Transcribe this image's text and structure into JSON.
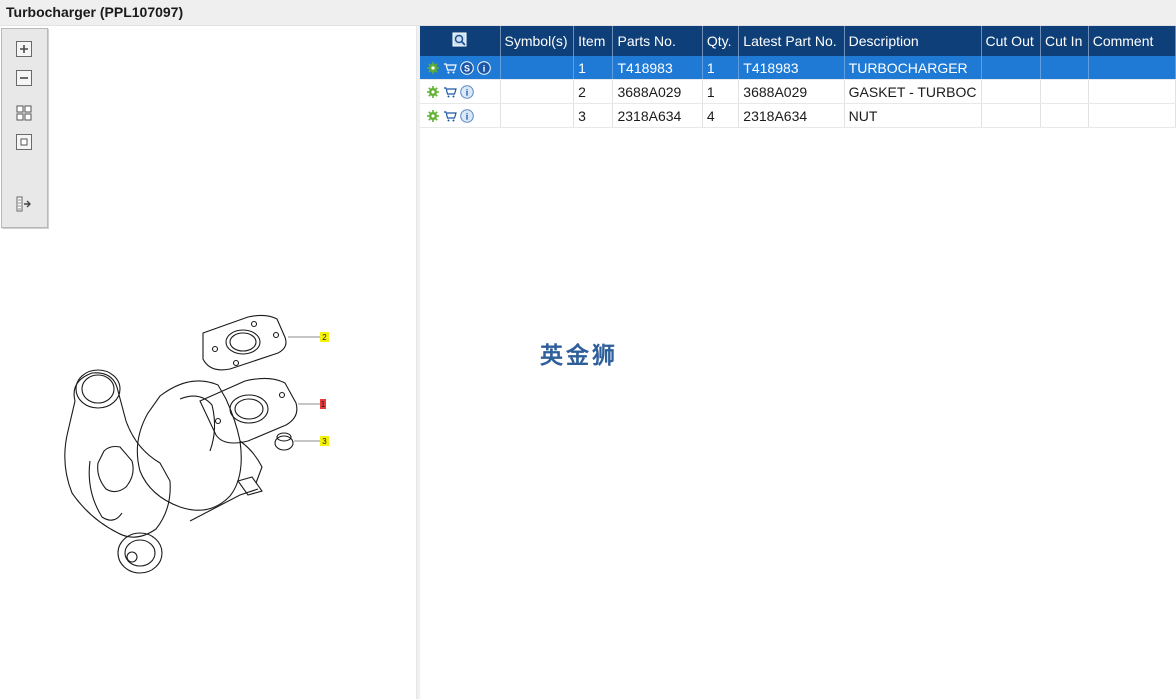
{
  "window": {
    "title": "Turbocharger (PPL107097)"
  },
  "toolbar": {
    "buttons": [
      {
        "icon": "zoom-in-icon"
      },
      {
        "icon": "zoom-out-icon"
      },
      {
        "icon": "fit-all-icon"
      },
      {
        "icon": "actual-size-icon"
      },
      {
        "icon": "toggle-panel-icon"
      }
    ]
  },
  "drawing": {
    "callouts": [
      "2",
      "1",
      "3"
    ]
  },
  "grid": {
    "columns": [
      "",
      "Symbol(s)",
      "Item",
      "Parts No.",
      "Qty.",
      "Latest Part No.",
      "Description",
      "Cut Out",
      "Cut In",
      "Comment"
    ],
    "rows": [
      {
        "item": "1",
        "part_no": "T418983",
        "qty": "1",
        "latest_part_no": "T418983",
        "description": "TURBOCHARGER",
        "symbols": "",
        "cut_out": "",
        "cut_in": "",
        "comment": "",
        "has_s": true
      },
      {
        "item": "2",
        "part_no": "3688A029",
        "qty": "1",
        "latest_part_no": "3688A029",
        "description": "GASKET - TURBOC",
        "symbols": "",
        "cut_out": "",
        "cut_in": "",
        "comment": "",
        "has_s": false
      },
      {
        "item": "3",
        "part_no": "2318A634",
        "qty": "4",
        "latest_part_no": "2318A634",
        "description": "NUT",
        "symbols": "",
        "cut_out": "",
        "cut_in": "",
        "comment": "",
        "has_s": false
      }
    ],
    "selected_row": 0
  },
  "watermark": "英金狮",
  "colors": {
    "header_bg": "#0e3f79",
    "selected_row": "#1f7ad6",
    "callout_yellow": "#f4f20a",
    "callout_red": "#e83a3a"
  }
}
